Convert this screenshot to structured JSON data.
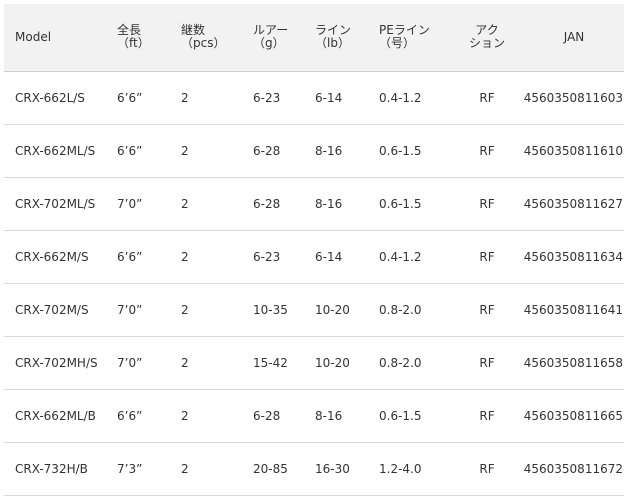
{
  "headers": {
    "model": "Model",
    "length_label": "全長",
    "length_unit": "（ft）",
    "pieces_label": "継数",
    "pieces_unit": "（pcs）",
    "lure_label": "ルアー",
    "lure_unit": "（g）",
    "line_label": "ライン",
    "line_unit": "（lb）",
    "pe_label": "PEライン",
    "pe_unit": "（号）",
    "action_line1": "アク",
    "action_line2": "ション",
    "jan": "JAN"
  },
  "rows": [
    {
      "model": "CRX-662L/S",
      "length": "6’6”",
      "pieces": "2",
      "lure": "6-23",
      "line": "6-14",
      "pe": "0.4-1.2",
      "action": "RF",
      "jan": "4560350811603"
    },
    {
      "model": "CRX-662ML/S",
      "length": "6’6”",
      "pieces": "2",
      "lure": "6-28",
      "line": "8-16",
      "pe": "0.6-1.5",
      "action": "RF",
      "jan": "4560350811610"
    },
    {
      "model": "CRX-702ML/S",
      "length": "7’0”",
      "pieces": "2",
      "lure": "6-28",
      "line": "8-16",
      "pe": "0.6-1.5",
      "action": "RF",
      "jan": "4560350811627"
    },
    {
      "model": "CRX-662M/S",
      "length": "6’6”",
      "pieces": "2",
      "lure": "6-23",
      "line": "6-14",
      "pe": "0.4-1.2",
      "action": "RF",
      "jan": "4560350811634"
    },
    {
      "model": "CRX-702M/S",
      "length": "7’0”",
      "pieces": "2",
      "lure": "10-35",
      "line": "10-20",
      "pe": "0.8-2.0",
      "action": "RF",
      "jan": "4560350811641"
    },
    {
      "model": "CRX-702MH/S",
      "length": "7’0”",
      "pieces": "2",
      "lure": "15-42",
      "line": "10-20",
      "pe": "0.8-2.0",
      "action": "RF",
      "jan": "4560350811658"
    },
    {
      "model": "CRX-662ML/B",
      "length": "6’6”",
      "pieces": "2",
      "lure": "6-28",
      "line": "8-16",
      "pe": "0.6-1.5",
      "action": "RF",
      "jan": "4560350811665"
    },
    {
      "model": "CRX-732H/B",
      "length": "7’3”",
      "pieces": "2",
      "lure": "20-85",
      "line": "16-30",
      "pe": "1.2-4.0",
      "action": "RF",
      "jan": "4560350811672"
    }
  ]
}
